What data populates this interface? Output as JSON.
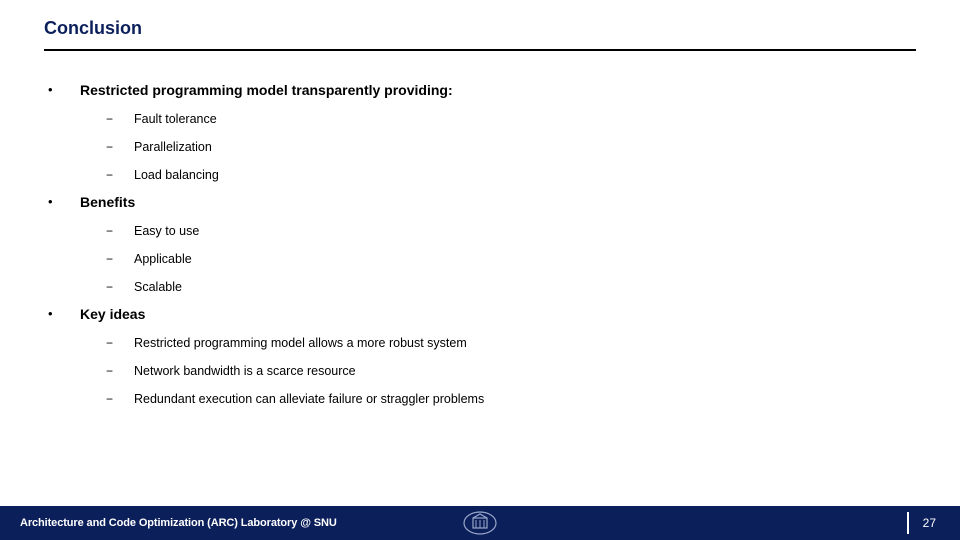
{
  "title": "Conclusion",
  "sections": [
    {
      "heading": "Restricted programming model transparently providing:",
      "items": [
        "Fault tolerance",
        "Parallelization",
        "Load balancing"
      ]
    },
    {
      "heading": "Benefits",
      "items": [
        "Easy to use",
        "Applicable",
        "Scalable"
      ]
    },
    {
      "heading": "Key ideas",
      "items": [
        "Restricted programming model allows a more robust system",
        "Network bandwidth is a scarce resource",
        "Redundant execution can alleviate failure or straggler problems"
      ]
    }
  ],
  "footer": {
    "text": "Architecture and Code Optimization (ARC) Laboratory @ SNU",
    "page": "27"
  }
}
